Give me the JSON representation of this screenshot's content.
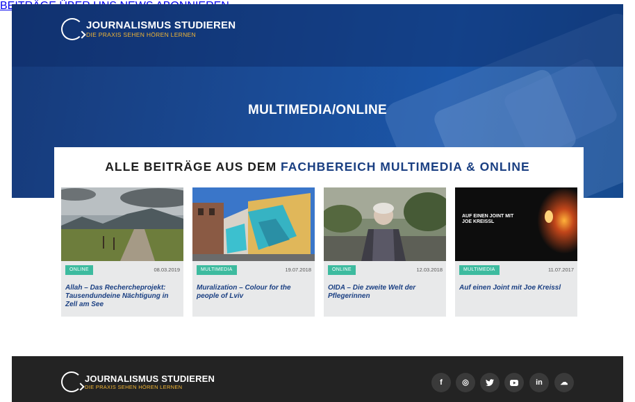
{
  "header": {
    "logo_title": "JOURNALISMUS STUDIEREN",
    "logo_tagline": "DIE PRAXIS SEHEN HÖREN LERNEN",
    "nav": [
      "BEITRÄGE",
      "ÜBER UNS",
      "NEWS",
      "ABONNIEREN"
    ]
  },
  "hero": {
    "title": "MULTIMEDIA/ONLINE"
  },
  "section": {
    "heading_prefix": "ALLE BEITRÄGE AUS DEM ",
    "heading_highlight": "FACHBEREICH MULTIMEDIA & ONLINE"
  },
  "posts": [
    {
      "tag": "ONLINE",
      "date": "08.03.2019",
      "title": "Allah – Das Rechercheprojekt: Tausendundeine Nächtigung in Zell am See"
    },
    {
      "tag": "MULTIMEDIA",
      "date": "19.07.2018",
      "title": "Muralization – Colour for the people of Lviv"
    },
    {
      "tag": "ONLINE",
      "date": "12.03.2018",
      "title": "OIDA – Die zweite Welt der Pflegerinnen"
    },
    {
      "tag": "MULTIMEDIA",
      "date": "11.07.2017",
      "title": "Auf einen Joint mit Joe Kreissl",
      "image_caption": "AUF EINEN JOINT MIT JOE KREISSL"
    }
  ],
  "footer": {
    "logo_title": "JOURNALISMUS STUDIEREN",
    "logo_tagline": "DIE PRAXIS SEHEN HÖREN LERNEN",
    "social": [
      {
        "icon": "facebook-icon",
        "glyph": "f"
      },
      {
        "icon": "instagram-icon",
        "glyph": "◎"
      },
      {
        "icon": "twitter-icon",
        "glyph": "🐦"
      },
      {
        "icon": "youtube-icon",
        "glyph": "▶"
      },
      {
        "icon": "linkedin-icon",
        "glyph": "in"
      },
      {
        "icon": "soundcloud-icon",
        "glyph": "☁"
      }
    ]
  },
  "colors": {
    "brand_blue": "#1a3f82",
    "accent_gold": "#f3b634",
    "tag_green": "#3dbb9f",
    "footer_bg": "#232323"
  }
}
